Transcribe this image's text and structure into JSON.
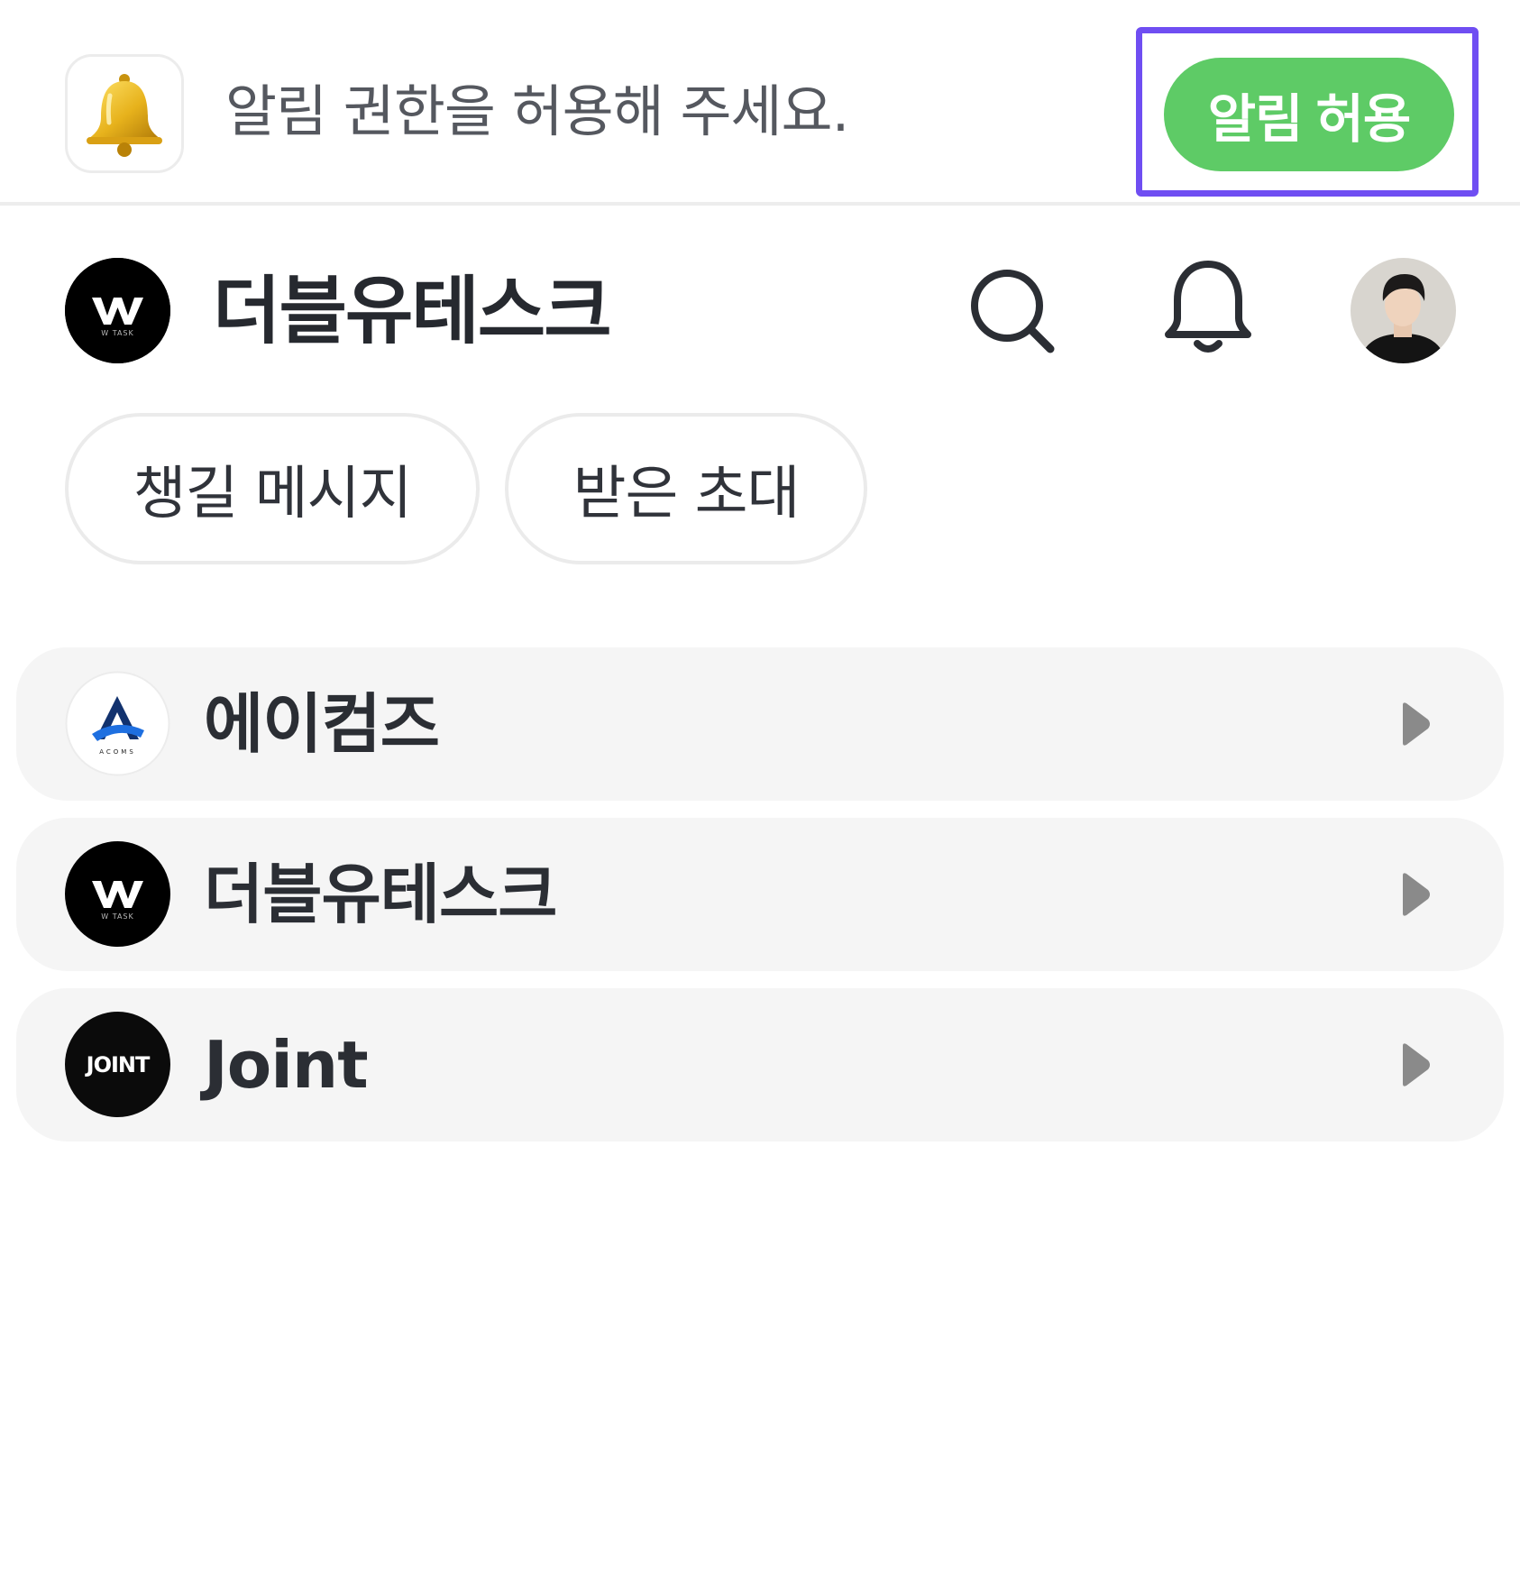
{
  "permission_banner": {
    "message": "알림 권한을 허용해 주세요.",
    "allow_label": "알림 허용",
    "icon": "bell-emoji-icon"
  },
  "header": {
    "org_logo_text": "W TASK",
    "org_name": "더블유테스크",
    "icons": [
      "search-icon",
      "bell-icon"
    ]
  },
  "chips": [
    {
      "label": "챙길 메시지"
    },
    {
      "label": "받은 초대"
    }
  ],
  "workspaces": [
    {
      "name": "에이컴즈",
      "logo_text": "ACOMS"
    },
    {
      "name": "더블유테스크",
      "logo_text": "W TASK"
    },
    {
      "name": "Joint",
      "logo_text": "JOINT"
    }
  ],
  "colors": {
    "accent_green": "#5ecb66",
    "highlight_purple": "#6f4ef2",
    "card_bg": "#f5f5f5"
  }
}
